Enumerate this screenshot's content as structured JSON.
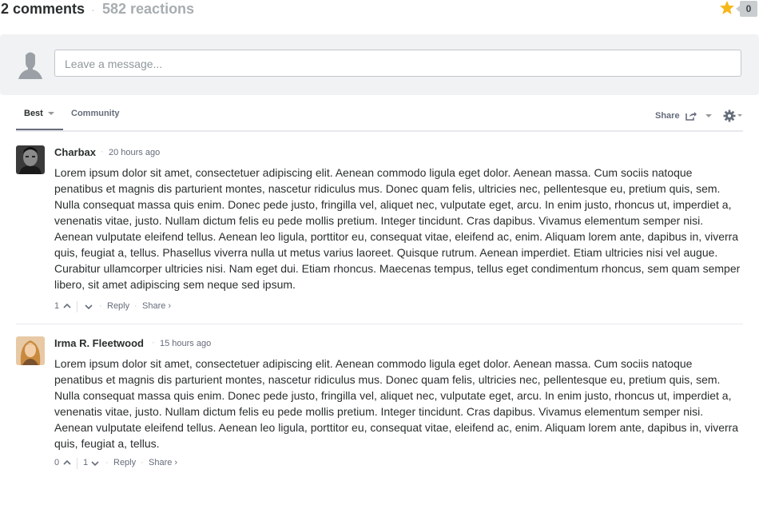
{
  "header": {
    "comments_count": "2 comments",
    "separator": "·",
    "reactions_count": "582 reactions",
    "star_count": "0"
  },
  "composer": {
    "placeholder": "Leave a message..."
  },
  "tabs": {
    "best": "Best",
    "community": "Community",
    "share": "Share"
  },
  "comments": [
    {
      "author": "Charbax",
      "time": "20 hours ago",
      "body": "Lorem ipsum dolor sit amet, consectetuer adipiscing elit. Aenean commodo ligula eget dolor. Aenean massa. Cum sociis natoque penatibus et magnis dis parturient montes, nascetur ridiculus mus. Donec quam felis, ultricies nec, pellentesque eu, pretium quis, sem. Nulla consequat massa quis enim. Donec pede justo, fringilla vel, aliquet nec, vulputate eget, arcu. In enim justo, rhoncus ut, imperdiet a, venenatis vitae, justo. Nullam dictum felis eu pede mollis pretium. Integer tincidunt. Cras dapibus. Vivamus elementum semper nisi. Aenean vulputate eleifend tellus. Aenean leo ligula, porttitor eu, consequat vitae, eleifend ac, enim. Aliquam lorem ante, dapibus in, viverra quis, feugiat a, tellus. Phasellus viverra nulla ut metus varius laoreet. Quisque rutrum. Aenean imperdiet. Etiam ultricies nisi vel augue. Curabitur ullamcorper ultricies nisi. Nam eget dui. Etiam rhoncus. Maecenas tempus, tellus eget condimentum rhoncus, sem quam semper libero, sit amet adipiscing sem neque sed ipsum.",
      "upvotes": "1",
      "downvotes": "",
      "reply": "Reply",
      "share": "Share ›"
    },
    {
      "author": "Irma R. Fleetwood",
      "time": "15 hours ago",
      "body": "Lorem ipsum dolor sit amet, consectetuer adipiscing elit. Aenean commodo ligula eget dolor. Aenean massa. Cum sociis natoque penatibus et magnis dis parturient montes, nascetur ridiculus mus. Donec quam felis, ultricies nec, pellentesque eu, pretium quis, sem. Nulla consequat massa quis enim. Donec pede justo, fringilla vel, aliquet nec, vulputate eget, arcu. In enim justo, rhoncus ut, imperdiet a, venenatis vitae, justo. Nullam dictum felis eu pede mollis pretium. Integer tincidunt. Cras dapibus. Vivamus elementum semper nisi. Aenean vulputate eleifend tellus. Aenean leo ligula, porttitor eu, consequat vitae, eleifend ac, enim. Aliquam lorem ante, dapibus in, viverra quis, feugiat a, tellus.",
      "upvotes": "0",
      "downvotes": "1",
      "reply": "Reply",
      "share": "Share ›"
    }
  ],
  "icons": {
    "star": "star-icon",
    "share": "share-icon",
    "gear": "gear-icon",
    "up": "chevron-up-icon",
    "down": "chevron-down-icon"
  },
  "colors": {
    "star": "#f5b819",
    "text": "#2a2e2e",
    "muted": "#656c7a",
    "panel": "#f1f2f3"
  }
}
